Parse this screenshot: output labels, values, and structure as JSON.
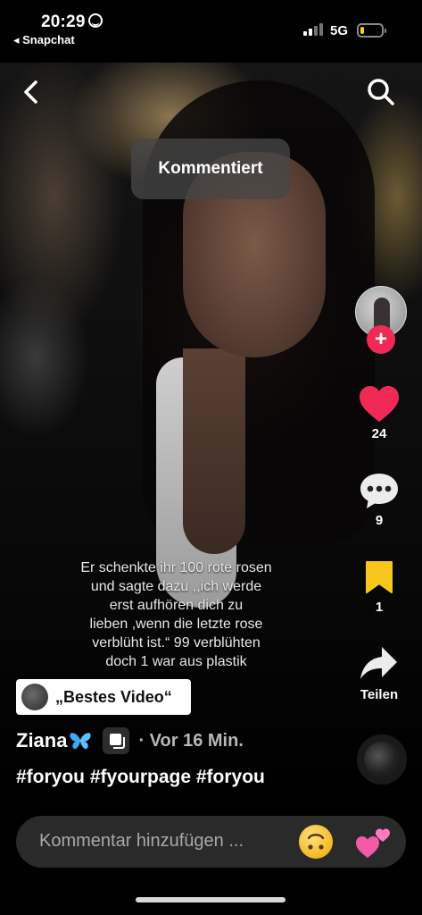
{
  "status_bar": {
    "time": "20:29",
    "back_app": "◂ Snapchat",
    "network": "5G",
    "battery_level": 0.2,
    "battery_color": "#f7d21a"
  },
  "video": {
    "toast": "Kommentiert",
    "overlay_text": "Er schenkte ihr 100 rote rosen\nund sagte dazu ,,ich werde\nerst aufhören dich zu\nlieben ,wenn die letzte rose\nverblüht ist.“ 99 verblühten\ndoch 1 war aus plastik"
  },
  "actions": {
    "likes": "24",
    "comments": "9",
    "saves": "1",
    "share_label": "Teilen",
    "like_color": "#f02a55",
    "save_color": "#f7c71d"
  },
  "post": {
    "label": "„Bestes Video“",
    "author": "Ziana",
    "time_ago": "· Vor 16 Min.",
    "hashtags": "#foryou #fyourpage #foryou"
  },
  "comment_bar": {
    "placeholder": "Kommentar hinzufügen ..."
  },
  "icons": [
    "back-arrow-icon",
    "search-icon",
    "heart-icon",
    "comment-bubble-icon",
    "bookmark-icon",
    "share-arrow-icon",
    "butterfly-icon",
    "repost-icon",
    "upside-down-smile-emoji",
    "two-hearts-emoji"
  ]
}
